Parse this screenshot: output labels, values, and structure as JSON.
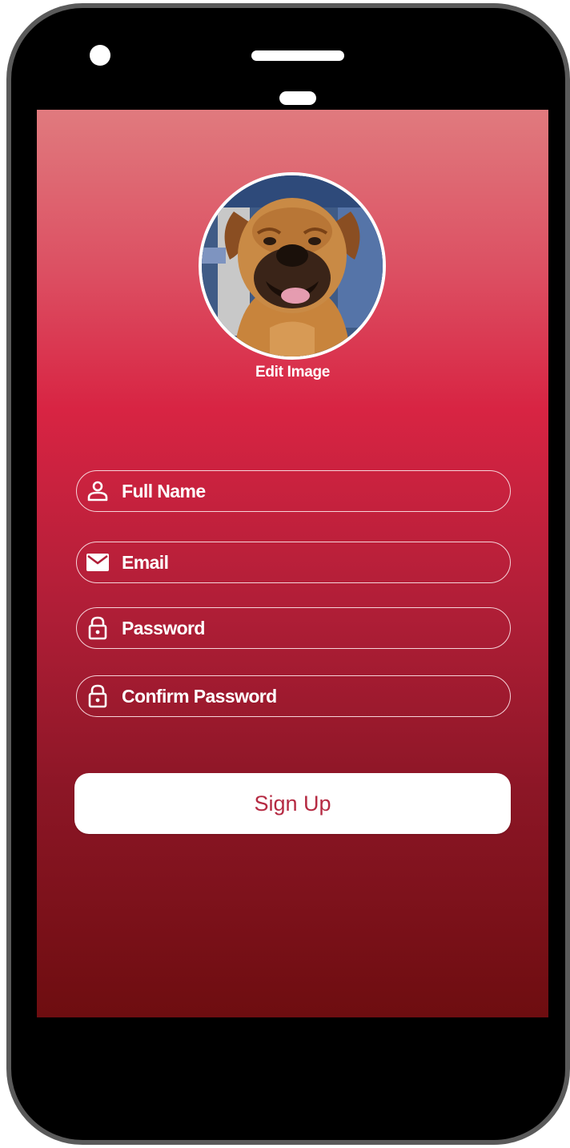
{
  "profile": {
    "edit_image_label": "Edit Image",
    "avatar_alt": "profile photo"
  },
  "form": {
    "fields": [
      {
        "label": "Full Name",
        "icon": "person-icon"
      },
      {
        "label": "Email",
        "icon": "mail-icon"
      },
      {
        "label": "Password",
        "icon": "lock-icon"
      },
      {
        "label": "Confirm Password",
        "icon": "lock-icon"
      }
    ],
    "submit_label": "Sign Up"
  },
  "colors": {
    "accent": "#d82443",
    "button_text": "#b52a42",
    "phone_bezel": "#000000"
  }
}
